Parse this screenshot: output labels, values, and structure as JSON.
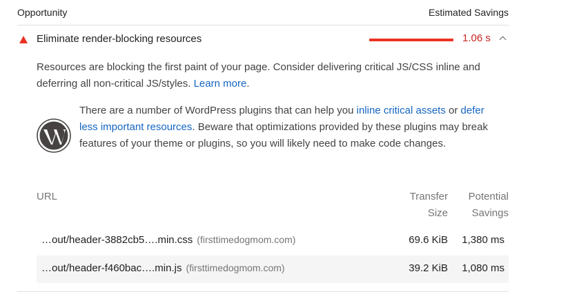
{
  "header": {
    "left_label": "Opportunity",
    "right_label": "Estimated Savings"
  },
  "audit": {
    "title": "Eliminate render-blocking resources",
    "savings": "1.06 s",
    "colors": {
      "fail": "#eb3223",
      "link": "#1565c0"
    }
  },
  "description": {
    "text": "Resources are blocking the first paint of your page. Consider delivering critical JS/CSS inline and deferring all non-critical JS/styles.",
    "link": "Learn more",
    "end": "."
  },
  "wordpress_note": {
    "t1": "There are a number of WordPress plugins that can help you",
    "link1": "inline critical assets",
    "t2": "or",
    "link2": "defer less important resources",
    "t3": ". Beware that optimizations provided by these plugins may break features of your theme or plugins, so you will likely need to make code changes.",
    "icon": "wordpress-logo"
  },
  "table": {
    "headers": {
      "url": "URL",
      "size_l1": "Transfer",
      "size_l2": "Size",
      "save_l1": "Potential",
      "save_l2": "Savings"
    },
    "rows": [
      {
        "url": "…out/header-3882cb5….min.css",
        "host": "(firsttimedogmom.com)",
        "size": "69.6 KiB",
        "savings": "1,380 ms"
      },
      {
        "url": "…out/header-f460bac….min.js",
        "host": "(firsttimedogmom.com)",
        "size": "39.2 KiB",
        "savings": "1,080 ms"
      }
    ]
  }
}
